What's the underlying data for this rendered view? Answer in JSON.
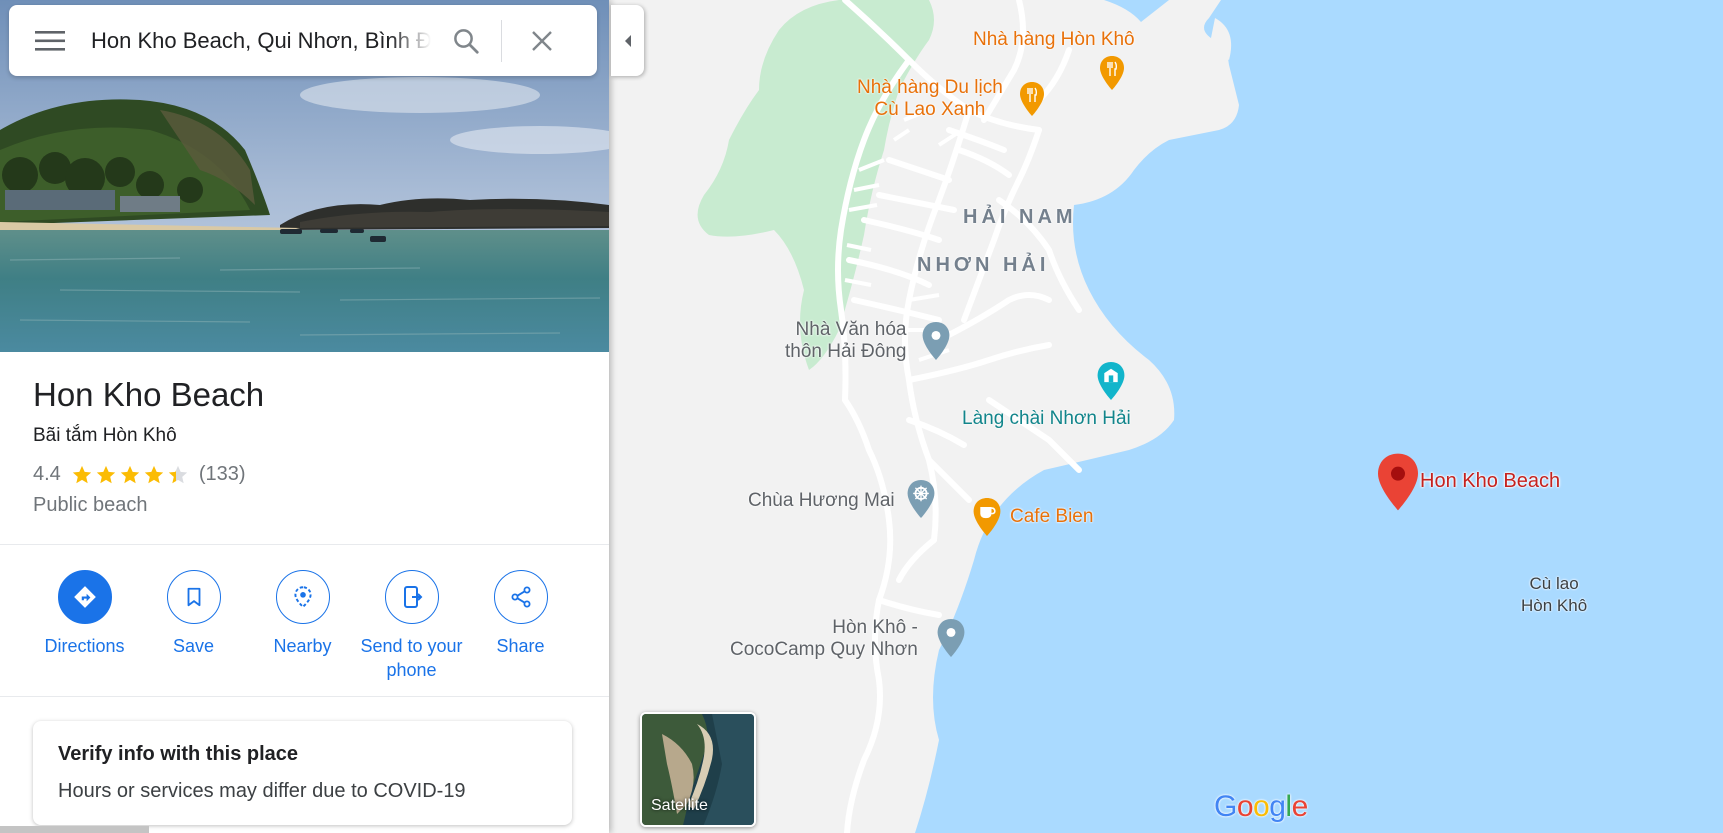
{
  "search": {
    "query": "Hon Kho Beach, Qui Nhơn, Bình Định"
  },
  "place": {
    "title": "Hon Kho Beach",
    "subtitle": "Bãi tắm Hòn Khô",
    "rating": "4.4",
    "rating_value": 4.4,
    "rating_max": 5,
    "reviews": "(133)",
    "category": "Public beach"
  },
  "actions": [
    {
      "label": "Directions",
      "icon": "directions-icon"
    },
    {
      "label": "Save",
      "icon": "bookmark-icon"
    },
    {
      "label": "Nearby",
      "icon": "nearby-icon"
    },
    {
      "label": "Send to your phone",
      "icon": "send-to-phone-icon"
    },
    {
      "label": "Share",
      "icon": "share-icon"
    }
  ],
  "verify": {
    "title": "Verify info with this place",
    "text": "Hours or services may differ due to COVID-19"
  },
  "map": {
    "labels": {
      "nha_hang_hon_kho": "Nhà hàng Hòn Khô",
      "nha_hang_du_lich_1": "Nhà hàng Du lịch",
      "nha_hang_du_lich_2": "Cù Lao Xanh",
      "hai_nam": "HẢI NAM",
      "nhon_hai": "NHƠN HẢI",
      "nha_van_hoa_1": "Nhà Văn hóa",
      "nha_van_hoa_2": "thôn Hải Đông",
      "lang_chai": "Làng chài Nhơn Hải",
      "chua_huong_mai": "Chùa Hương Mai",
      "cafe_bien": "Cafe Bien",
      "hon_kho_coco_1": "Hòn Khô -",
      "hon_kho_coco_2": "CocoCamp Quy Nhơn",
      "selected_place": "Hon Kho Beach",
      "cu_lao_1": "Cù lao",
      "cu_lao_2": "Hòn Khô"
    },
    "satellite_label": "Satellite",
    "logo": "Google",
    "colors": {
      "water": "#aadaff",
      "land": "#f2f2f2",
      "park": "#c8ebd0",
      "pin": "#ea4335",
      "accent": "#1a73e8"
    }
  }
}
